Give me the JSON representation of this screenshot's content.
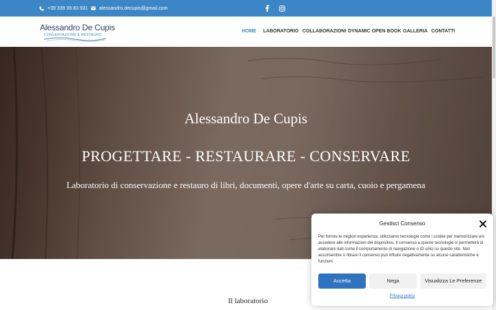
{
  "topbar": {
    "phone": "+39 339 35 83 931",
    "email": "alessandro.decupis@gmail.com",
    "phone_icon": "phone-icon",
    "email_icon": "envelope-icon",
    "social_icons": [
      "facebook-icon",
      "instagram-icon"
    ]
  },
  "logo": {
    "title": "Alessandro De Cupis",
    "subtitle": "CONSERVAZIONE E RESTAURO"
  },
  "nav": {
    "items": [
      "HOME",
      "LABORATORIO",
      "COLLABORAZIONI",
      "DYNAMIC OPEN BOOK",
      "GALLERIA",
      "CONTATTI"
    ],
    "active": "HOME"
  },
  "hero": {
    "name": "Alessandro De Cupis",
    "tagline": "PROGETTARE - RESTAURARE - CONSERVARE",
    "subtitle": "Laboratorio di conservazione e restauro di libri, documenti, opere d'arte su carta, cuoio e pergamena"
  },
  "section": {
    "title": "Il laboratorio"
  },
  "consent": {
    "title": "Gestisci Consenso",
    "text": "Per fornire le migliori esperienze, utilizziamo tecnologie come i cookie per memorizzare e/o accedere alle informazioni del dispositivo. Il consenso a queste tecnologie ci permetterà di elaborare dati come il comportamento di navigazione o ID unici su questo sito. Non acconsentire o ritirare il consenso può influire negativamente su alcune caratteristiche e funzioni.",
    "accept_label": "Accetta",
    "deny_label": "Nega",
    "preferences_label": "Visualizza Le Preferenze",
    "privacy_label": "Privacy policy"
  },
  "colors": {
    "accent": "#3c86c6",
    "accept_button": "#2f73c0"
  }
}
